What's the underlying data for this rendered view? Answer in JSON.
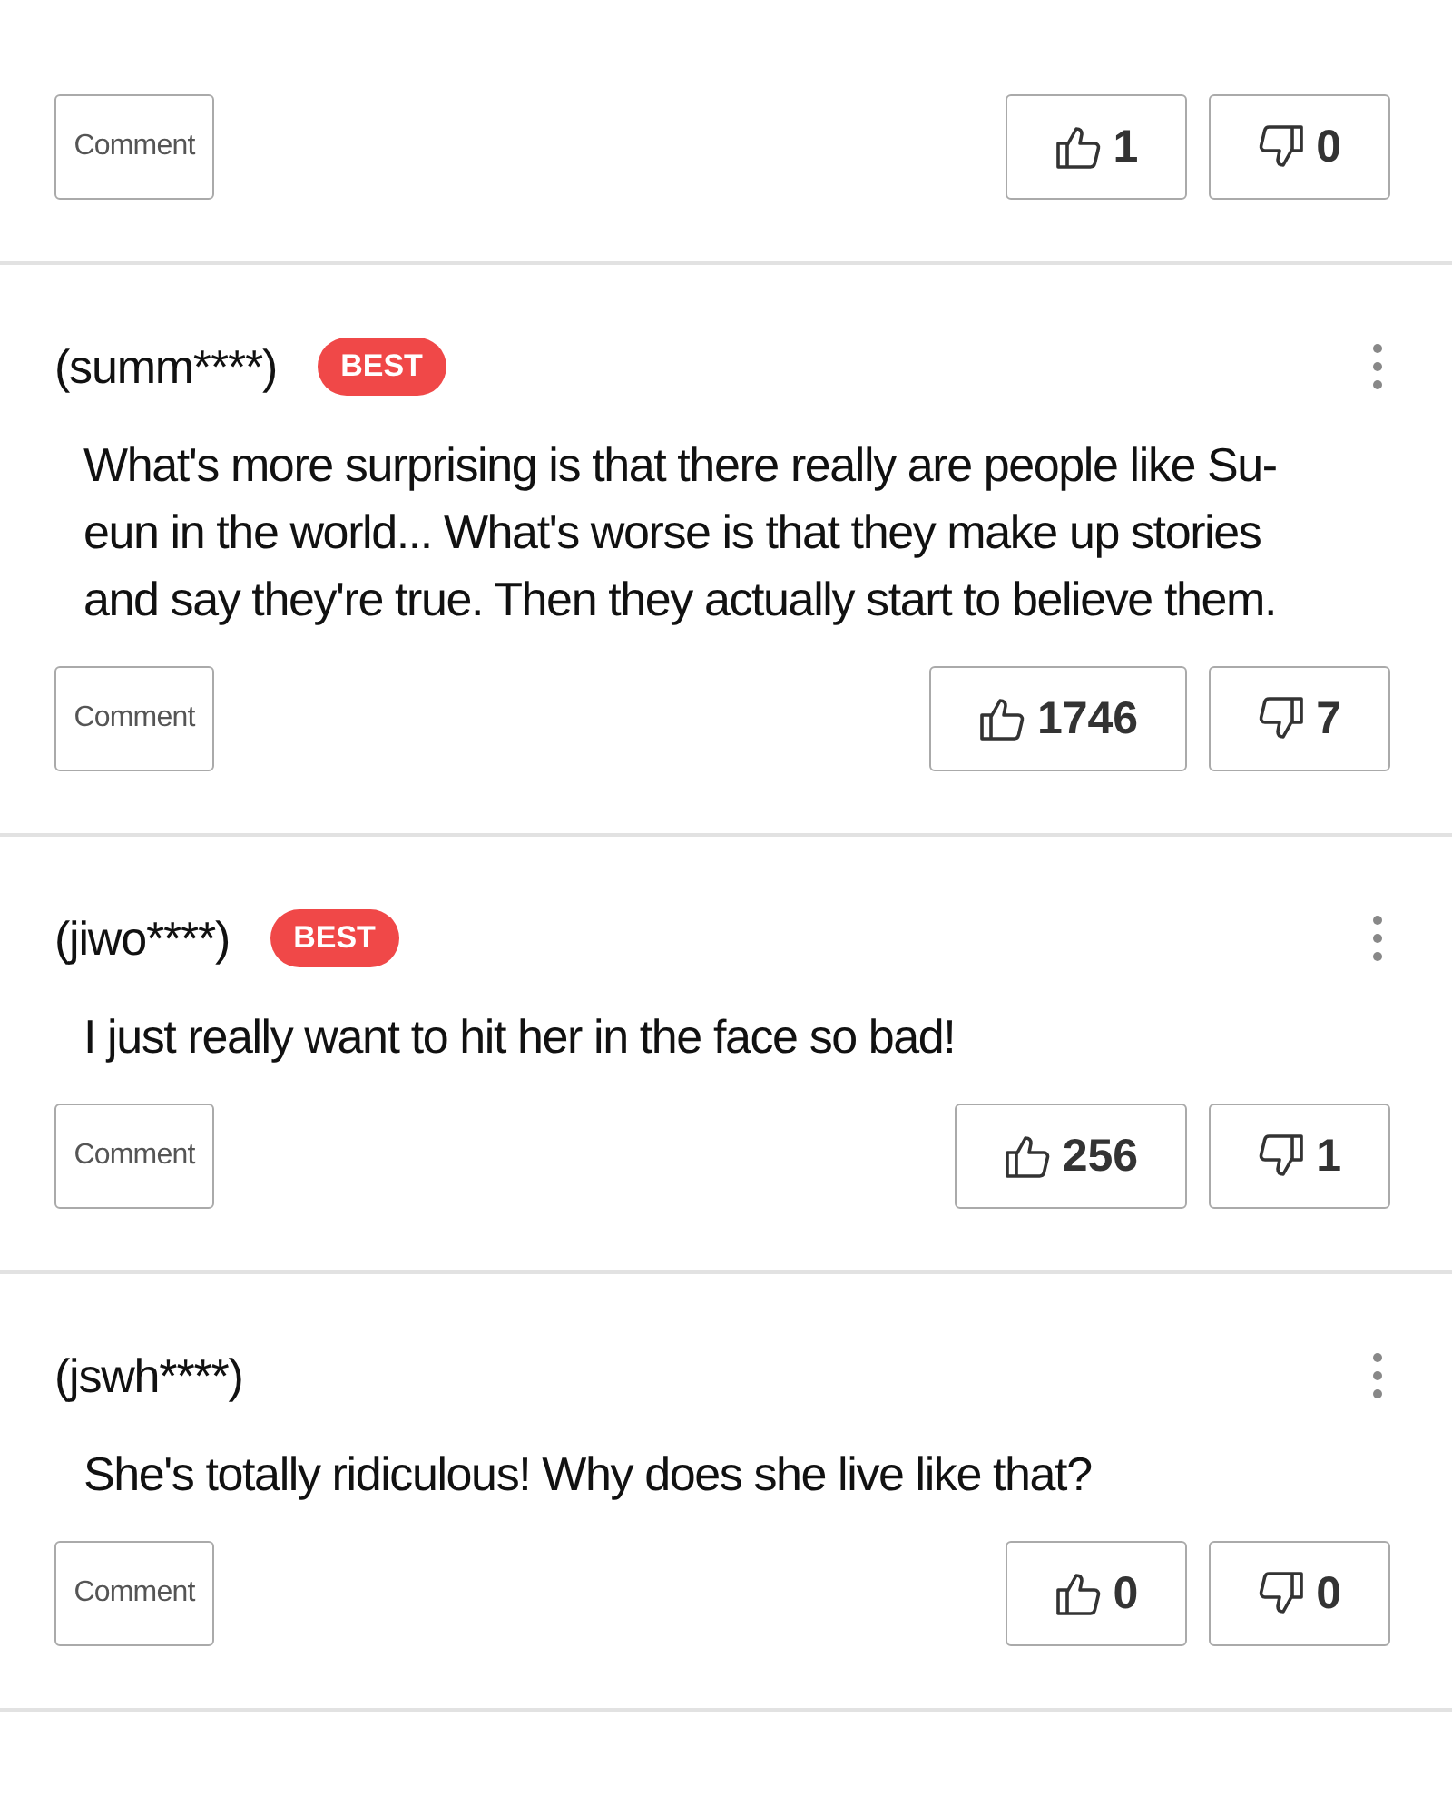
{
  "comments": [
    {
      "comment_button": "Comment",
      "likes": "1",
      "dislikes": "0"
    },
    {
      "author": "(summ****)",
      "badge": "BEST",
      "text": "What's more surprising is that there really are people like Su-eun in the world... What's worse is that they make up stories and say they're true. Then they actually start to believe them.",
      "comment_button": "Comment",
      "likes": "1746",
      "dislikes": "7"
    },
    {
      "author": "(jiwo****)",
      "badge": "BEST",
      "text": "I just really want to hit her in the face so bad!",
      "comment_button": "Comment",
      "likes": "256",
      "dislikes": "1"
    },
    {
      "author": "(jswh****)",
      "text": "She's totally ridiculous! Why does she live like that?",
      "comment_button": "Comment",
      "likes": "0",
      "dislikes": "0"
    }
  ]
}
